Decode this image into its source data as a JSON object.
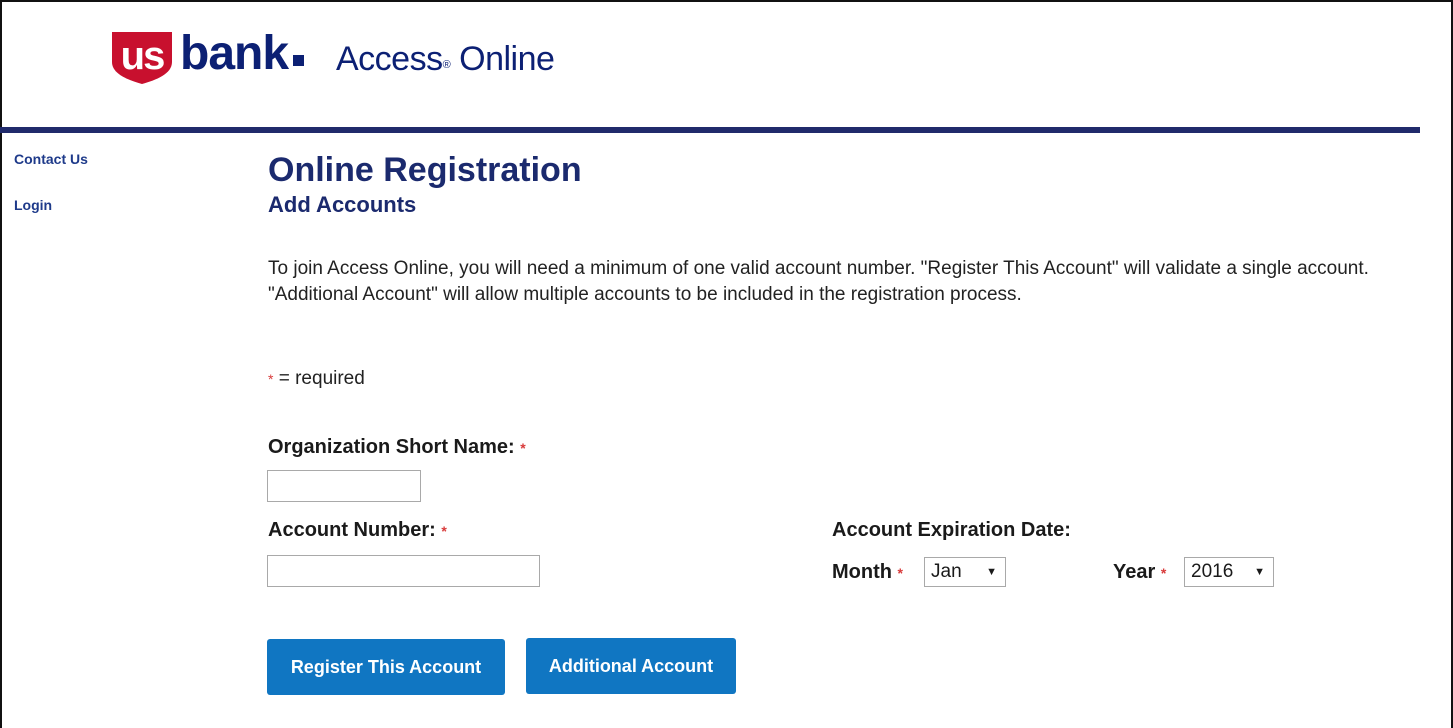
{
  "header": {
    "logo_us": "us",
    "logo_bank": "bank",
    "product_name": "Access",
    "product_registered": "®",
    "product_suffix": " Online"
  },
  "sidebar": {
    "items": [
      {
        "label": "Contact Us"
      },
      {
        "label": "Login"
      }
    ]
  },
  "main": {
    "title": "Online Registration",
    "subtitle": "Add Accounts",
    "intro": "To join Access Online, you will need a minimum of one valid account number.  \"Register This Account\" will validate a single account.  \"Additional Account\" will allow multiple accounts to be included in the registration process.",
    "required_star": "*",
    "required_text": " = required",
    "org_label": "Organization Short Name:",
    "org_value": "",
    "account_label": "Account Number:",
    "account_value": "",
    "expiration_label": "Account Expiration Date:",
    "month_label": "Month",
    "month_value": "Jan",
    "year_label": "Year",
    "year_value": "2016",
    "register_button": "Register This Account",
    "additional_button": "Additional Account"
  },
  "colors": {
    "brand_navy": "#0c2074",
    "brand_red": "#c8102e",
    "button_blue": "#1076c2",
    "required_red": "#d83a3a"
  }
}
